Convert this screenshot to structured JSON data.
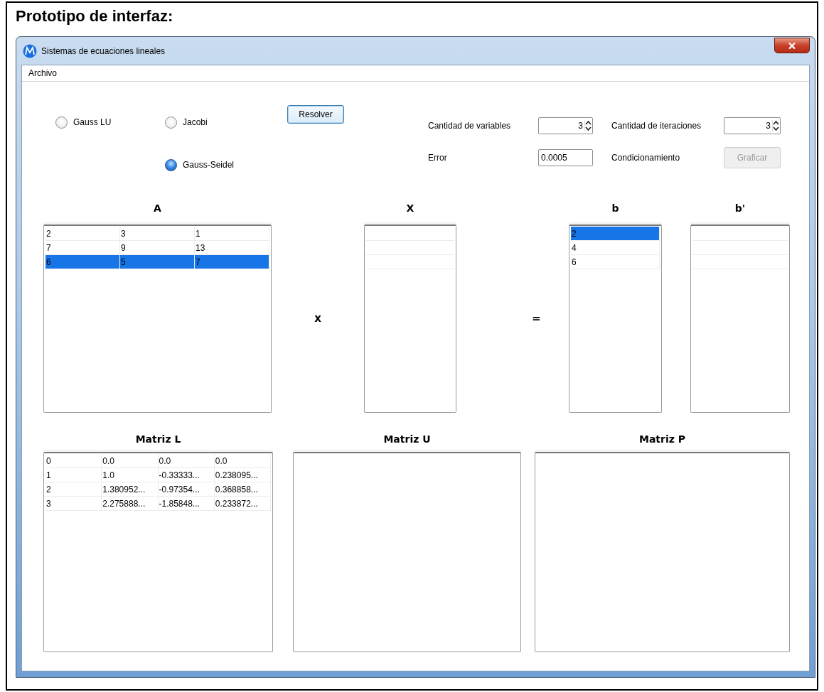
{
  "document_heading": "Prototipo de interfaz:",
  "window": {
    "title": "Sistemas de ecuaciones lineales"
  },
  "menu": [
    "Archivo"
  ],
  "methods": [
    {
      "label": "Gauss LU",
      "selected": false
    },
    {
      "label": "Jacobi",
      "selected": false
    },
    {
      "label": "Gauss-Seidel",
      "selected": true
    }
  ],
  "solve_button": "Resolver",
  "parameters": [
    {
      "kind": "spinner",
      "label": "Cantidad de variables",
      "value": "3"
    },
    {
      "kind": "spinner",
      "label": "Cantidad de iteraciones",
      "value": "3"
    },
    {
      "kind": "text",
      "label": "Error",
      "value": "0.0005"
    },
    {
      "kind": "button",
      "label": "Condicionamiento",
      "button_label": "Graficar",
      "disabled": true
    }
  ],
  "operators": [
    "x",
    "="
  ],
  "matrices": [
    {
      "title": "A",
      "rows": [
        {
          "cells": [
            "2",
            "3",
            "1"
          ],
          "selected": false
        },
        {
          "cells": [
            "7",
            "9",
            "13"
          ],
          "selected": false
        },
        {
          "cells": [
            "6",
            "5",
            "7"
          ],
          "selected": true
        }
      ]
    },
    {
      "title": "X"
    },
    {
      "title": "b",
      "rows": [
        {
          "cells": [
            "2"
          ],
          "selected": true
        },
        {
          "cells": [
            "4"
          ],
          "selected": false
        },
        {
          "cells": [
            "6"
          ],
          "selected": false
        }
      ]
    },
    {
      "title": "b'"
    },
    {
      "title": "Matriz L",
      "rows": [
        {
          "cells": [
            "0",
            "0.0",
            "0.0",
            "0.0"
          ],
          "selected": false
        },
        {
          "cells": [
            "1",
            "1.0",
            "-0.33333...",
            "0.238095..."
          ],
          "selected": false
        },
        {
          "cells": [
            "2",
            "1.380952...",
            "-0.97354...",
            "0.368858..."
          ],
          "selected": false
        },
        {
          "cells": [
            "3",
            "2.275888...",
            "-1.85848...",
            "0.233872..."
          ],
          "selected": false
        }
      ]
    },
    {
      "title": "Matriz U"
    },
    {
      "title": "Matriz P"
    }
  ]
}
